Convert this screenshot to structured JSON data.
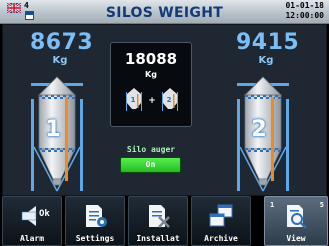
{
  "header": {
    "alarm_count": "4",
    "title": "SILOS WEIGHT",
    "date": "01-01-18",
    "time": "12:00:00"
  },
  "silos": [
    {
      "number": "1",
      "weight": "8673",
      "unit": "Kg",
      "fill_level": 0.0
    },
    {
      "number": "2",
      "weight": "9415",
      "unit": "Kg",
      "fill_level": 0.0
    }
  ],
  "total": {
    "value": "18088",
    "unit": "Kg",
    "formula": {
      "left": "1",
      "op": "+",
      "right": "2"
    }
  },
  "auger": {
    "label": "Silo auger",
    "state": "On",
    "color": "#2ed42a"
  },
  "nav": {
    "alarm": "Alarm",
    "alarm_status": "Ok",
    "settings": "Settings",
    "installation": "Installat",
    "archive": "Archive",
    "view": "View",
    "page_start": "1",
    "page_end": "5"
  },
  "colors": {
    "accent_blue": "#7bbdf4",
    "panel_bg": "#1e2732",
    "silo_stripe": "#f08a1c"
  }
}
